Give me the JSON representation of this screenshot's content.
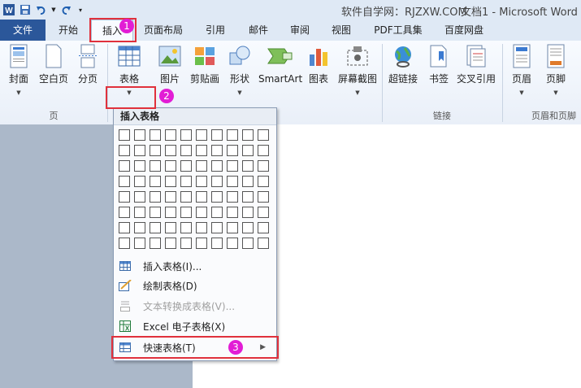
{
  "window": {
    "site_label": "软件自学网：RJZXW.COM",
    "document_title": "文档1 - Microsoft Word"
  },
  "tabs": [
    "文件",
    "开始",
    "插入",
    "页面布局",
    "引用",
    "邮件",
    "审阅",
    "视图",
    "PDF工具集",
    "百度网盘"
  ],
  "active_tab": "插入",
  "ribbon": {
    "buttons": [
      "封面",
      "空白页",
      "分页",
      "表格",
      "图片",
      "剪贴画",
      "形状",
      "SmartArt",
      "图表",
      "屏幕截图",
      "超链接",
      "书签",
      "交叉引用",
      "页眉",
      "页脚"
    ],
    "groups": [
      "页",
      "链接",
      "页眉和页脚"
    ]
  },
  "table_menu": {
    "header": "插入表格",
    "grid_columns": 10,
    "grid_rows": 8,
    "items": [
      {
        "label": "插入表格(I)...",
        "enabled": true,
        "icon": "table-insert-icon"
      },
      {
        "label": "绘制表格(D)",
        "enabled": true,
        "icon": "pencil-table-icon"
      },
      {
        "label": "文本转换成表格(V)...",
        "enabled": false,
        "icon": "text-to-table-icon"
      },
      {
        "label": "Excel 电子表格(X)",
        "enabled": true,
        "icon": "excel-icon"
      },
      {
        "label": "快速表格(T)",
        "enabled": true,
        "icon": "quick-table-icon",
        "submenu": true
      }
    ]
  },
  "annotations": [
    "1",
    "2",
    "3"
  ],
  "colors": {
    "file_tab": "#2b579a",
    "highlight": "#e0313c",
    "badge": "#e21dd5"
  }
}
